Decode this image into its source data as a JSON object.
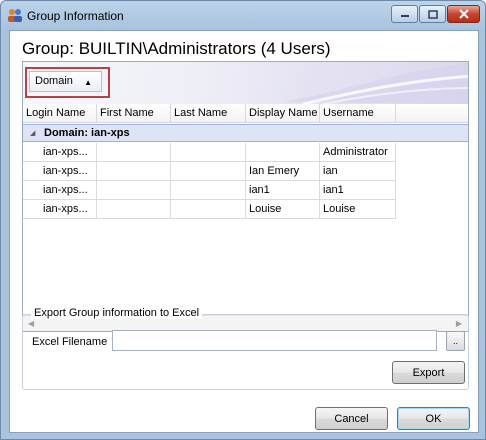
{
  "window": {
    "title": "Group Information",
    "icon": "users-group-icon"
  },
  "header": {
    "group_title": "Group: BUILTIN\\Administrators  (4 Users)"
  },
  "grid": {
    "group_by_chip": "Domain",
    "columns": [
      "Login Name",
      "First Name",
      "Last Name",
      "Display Name",
      "Username"
    ],
    "group_row_label": "Domain: ian-xps",
    "rows": [
      {
        "login": "ian-xps...",
        "first": "",
        "last": "",
        "display": "",
        "username": "Administrator"
      },
      {
        "login": "ian-xps...",
        "first": "",
        "last": "",
        "display": "Ian Emery",
        "username": "ian"
      },
      {
        "login": "ian-xps...",
        "first": "",
        "last": "",
        "display": "ian1",
        "username": "ian1"
      },
      {
        "login": "ian-xps...",
        "first": "",
        "last": "",
        "display": "Louise",
        "username": "Louise"
      }
    ]
  },
  "export": {
    "legend": "Export Group information to Excel",
    "filename_label": "Excel Filename",
    "filename_value": "",
    "browse_label": "..",
    "export_button": "Export"
  },
  "footer": {
    "cancel_button": "Cancel",
    "ok_button": "OK"
  }
}
